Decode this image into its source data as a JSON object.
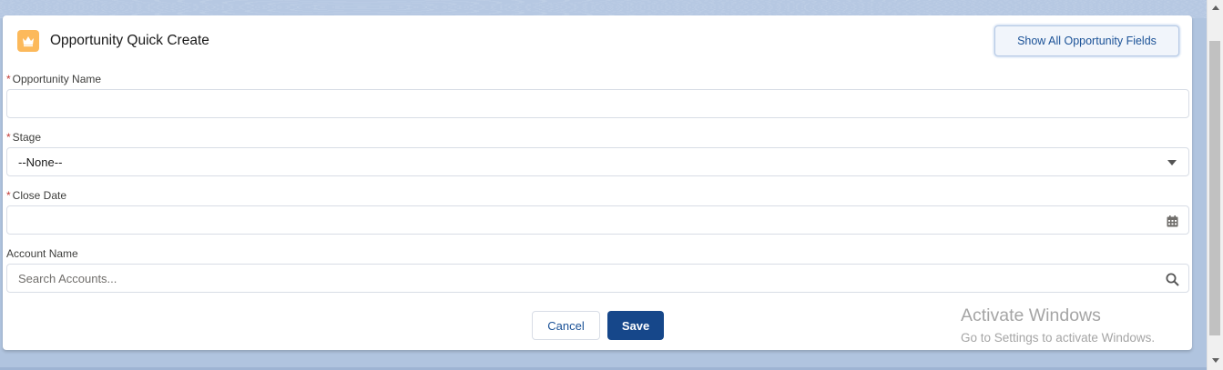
{
  "header": {
    "icon": "crown-icon",
    "icon_color": "#fcb95b",
    "title": "Opportunity Quick Create",
    "show_all_label": "Show All Opportunity Fields"
  },
  "fields": {
    "opportunity_name": {
      "required_marker": "*",
      "label": "Opportunity Name",
      "value": ""
    },
    "stage": {
      "required_marker": "*",
      "label": "Stage",
      "value": "--None--",
      "icon": "chevron-down-icon"
    },
    "close_date": {
      "required_marker": "*",
      "label": "Close Date",
      "value": "",
      "icon": "calendar-icon"
    },
    "account_name": {
      "label": "Account Name",
      "placeholder": "Search Accounts...",
      "icon": "search-icon"
    }
  },
  "footer": {
    "cancel_label": "Cancel",
    "save_label": "Save",
    "save_color": "#16478a"
  },
  "watermark": {
    "title": "Activate Windows",
    "subtitle": "Go to Settings to activate Windows."
  },
  "scrollbar": {
    "up_icon": "scroll-up-icon",
    "down_icon": "scroll-down-icon"
  }
}
